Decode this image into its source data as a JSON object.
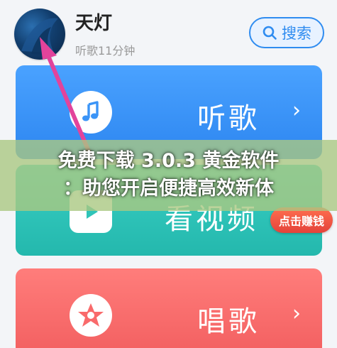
{
  "header": {
    "user_name": "天灯",
    "listen_time": "听歌11分钟",
    "search_label": "搜索"
  },
  "cards": {
    "listen": {
      "label": "听歌",
      "icon": "music-note-icon"
    },
    "video": {
      "label": "看视频",
      "icon": "play-icon"
    },
    "sing": {
      "label": "唱歌",
      "icon": "star-mic-icon"
    }
  },
  "reward_badge": "点击赚钱",
  "banner": {
    "line1": "免费下载 3.0.3 黄金软件",
    "line2": "：助您开启便捷高效新体"
  },
  "colors": {
    "listen_card": "#3a94f7",
    "video_card": "#2fc4b8",
    "sing_card": "#f96a6b",
    "arrow": "#e2439b",
    "accent": "#2f8cf0"
  }
}
